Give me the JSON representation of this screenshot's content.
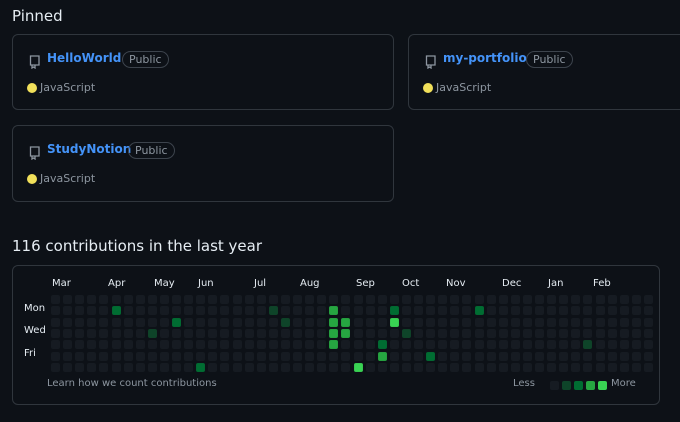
{
  "pinned": {
    "title": "Pinned",
    "repos": [
      {
        "name": "HelloWorld",
        "visibility": "Public",
        "language": "JavaScript",
        "language_color": "#f1e05a"
      },
      {
        "name": "my-portfolio",
        "visibility": "Public",
        "language": "JavaScript",
        "language_color": "#f1e05a"
      },
      {
        "name": "StudyNotion",
        "visibility": "Public",
        "language": "JavaScript",
        "language_color": "#f1e05a"
      }
    ]
  },
  "contributions": {
    "title": "116 contributions in the last year",
    "months": [
      "Mar",
      "Apr",
      "May",
      "Jun",
      "Jul",
      "Aug",
      "Sep",
      "Oct",
      "Nov",
      "Dec",
      "Jan",
      "Feb"
    ],
    "days": [
      "Mon",
      "Wed",
      "Fri"
    ],
    "learn_link": "Learn how we count contributions",
    "legend_less": "Less",
    "legend_more": "More",
    "level_colors": [
      "#161b22",
      "#0e4429",
      "#006d32",
      "#26a641",
      "#39d353"
    ],
    "empty_color": "#161b22",
    "active_cells": [
      [
        5,
        1,
        2
      ],
      [
        8,
        3,
        1
      ],
      [
        10,
        2,
        2
      ],
      [
        12,
        6,
        2
      ],
      [
        18,
        1,
        1
      ],
      [
        19,
        2,
        1
      ],
      [
        23,
        1,
        3
      ],
      [
        23,
        2,
        3
      ],
      [
        23,
        3,
        3
      ],
      [
        23,
        4,
        3
      ],
      [
        24,
        2,
        3
      ],
      [
        24,
        3,
        3
      ],
      [
        25,
        6,
        4
      ],
      [
        27,
        4,
        2
      ],
      [
        27,
        5,
        3
      ],
      [
        28,
        1,
        2
      ],
      [
        28,
        2,
        4
      ],
      [
        29,
        3,
        1
      ],
      [
        31,
        5,
        2
      ],
      [
        35,
        1,
        2
      ],
      [
        44,
        4,
        1
      ],
      [
        60,
        4,
        3
      ]
    ]
  }
}
